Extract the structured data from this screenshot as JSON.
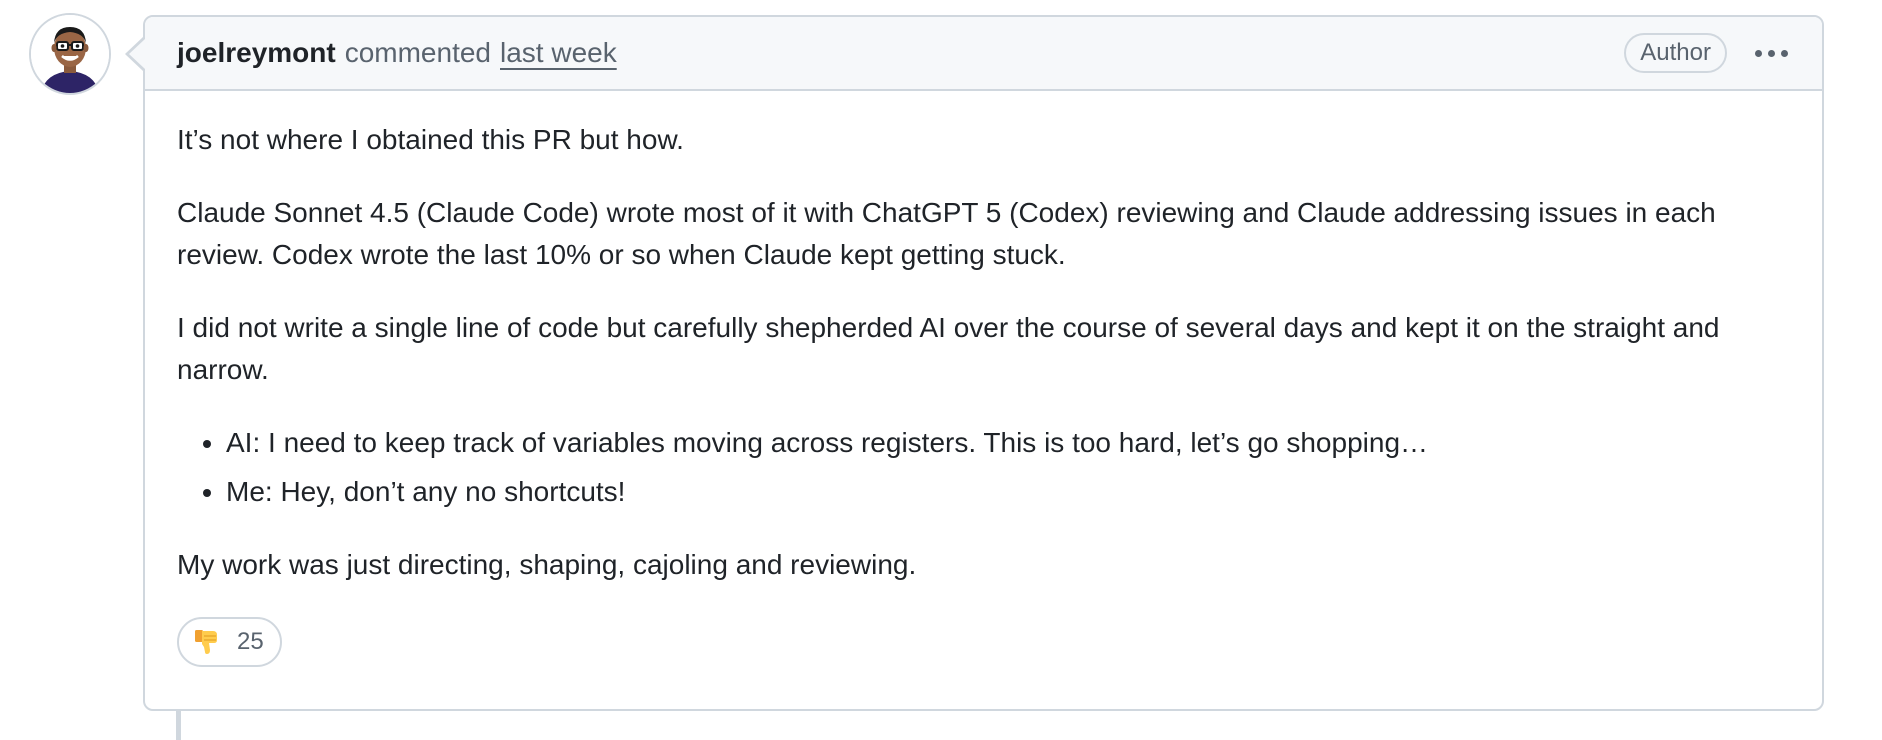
{
  "comment": {
    "author": "joelreymont",
    "action": "commented",
    "time": "last week",
    "badge": "Author",
    "paragraphs": [
      "It’s not where I obtained this PR but how.",
      "Claude Sonnet 4.5 (Claude Code) wrote most of it with ChatGPT 5 (Codex) reviewing and Claude addressing issues in each review. Codex wrote the last 10% or so when Claude kept getting stuck.",
      "I did not write a single line of code but carefully shepherded AI over the course of several days and kept it on the straight and narrow."
    ],
    "bullets": [
      "AI: I need to keep track of variables moving across registers. This is too hard, let’s go shopping…",
      "Me: Hey, don’t any no shortcuts!"
    ],
    "closing": "My work was just directing, shaping, cajoling and reviewing.",
    "reactions": [
      {
        "icon": "thumbs-down-icon",
        "count": "25"
      }
    ]
  },
  "colors": {
    "border": "#d0d7de",
    "header_bg": "#f6f8fa",
    "muted_text": "#59636e",
    "text": "#1f2328"
  }
}
